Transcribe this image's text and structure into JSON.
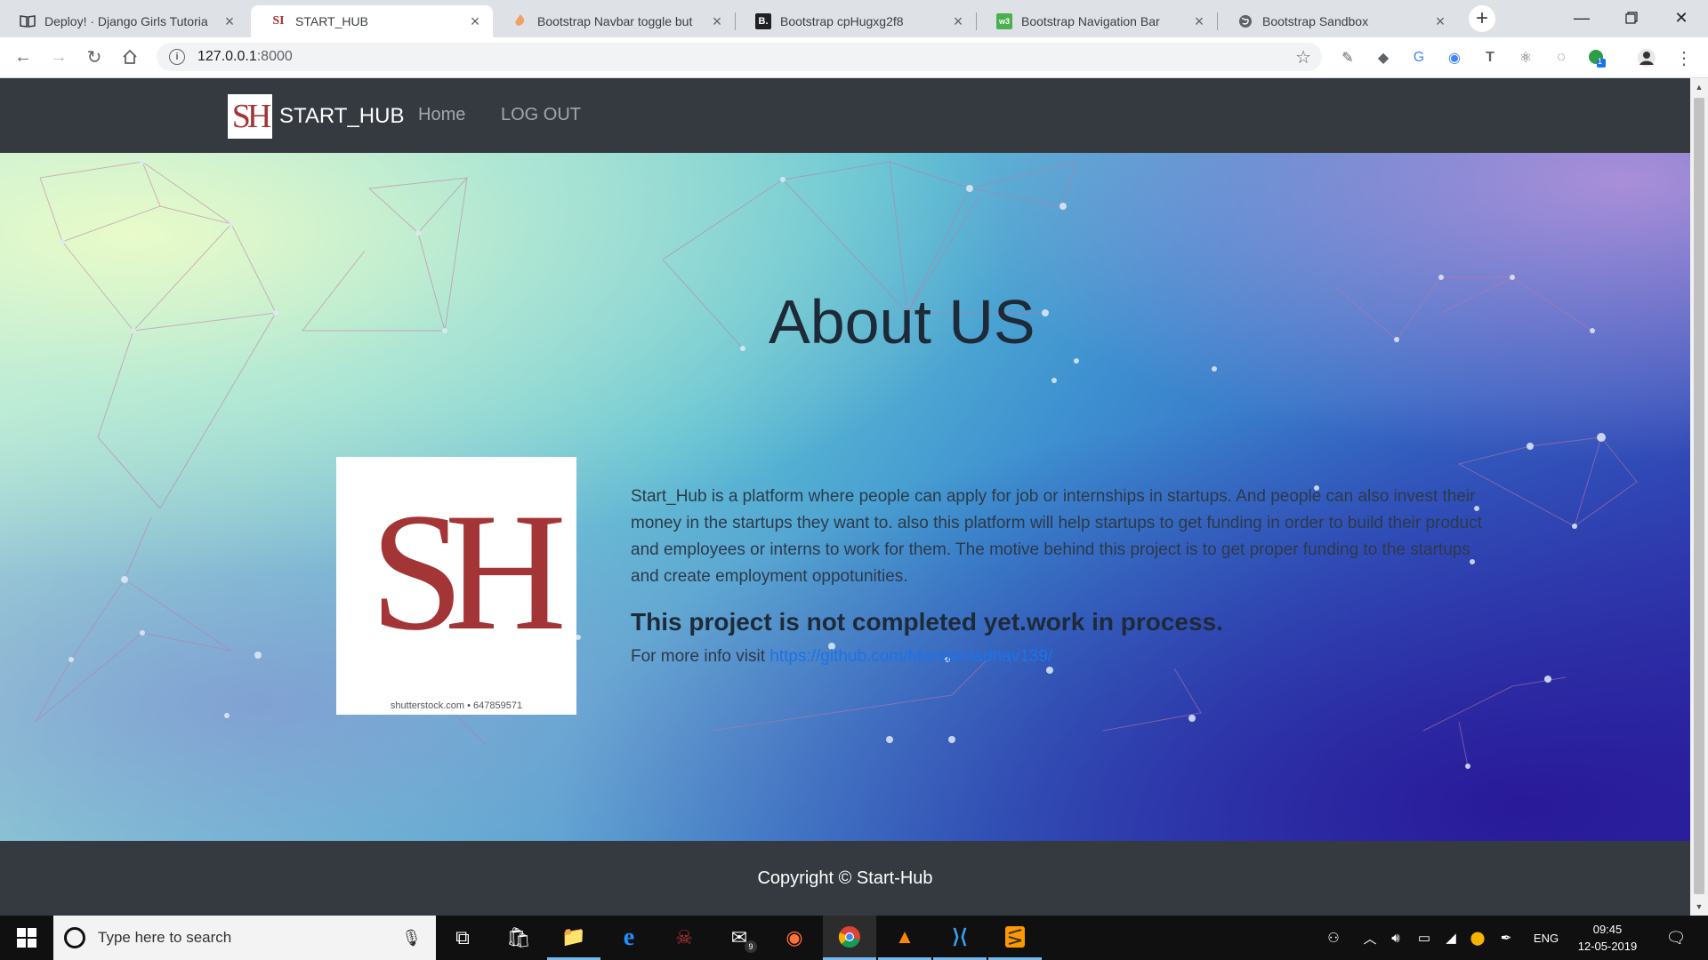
{
  "browser": {
    "tabs": [
      {
        "title": "Deploy! · Django Girls Tutoria",
        "favicon": "book-icon",
        "active": false
      },
      {
        "title": "START_HUB",
        "favicon": "sh-logo-icon",
        "active": true
      },
      {
        "title": "Bootstrap Navbar toggle but",
        "favicon": "codeply-icon",
        "active": false
      },
      {
        "title": "Bootstrap cpHugxg2f8",
        "favicon": "bootply-icon",
        "active": false
      },
      {
        "title": "Bootstrap Navigation Bar",
        "favicon": "w3-icon",
        "active": false
      },
      {
        "title": "Bootstrap Sandbox",
        "favicon": "globe-icon",
        "active": false
      }
    ],
    "url_host": "127.0.0.1",
    "url_port": ":8000",
    "extension_badge": "1"
  },
  "site": {
    "brand_mark": "SH",
    "brand_name": "START_HUB",
    "nav": {
      "home": "Home",
      "logout": "LOG OUT"
    },
    "about": {
      "title": "About US",
      "logo_mark": "SH",
      "logo_credit": "shutterstock.com • 647859571",
      "description": "Start_Hub is a platform where people can apply for job or internships in startups. And people can also invest their money in the startups they want to. also this platform will help startups to get funding in order to build their product and employees or interns to work for them. The motive behind this project is to get proper funding to the startups and create employment oppotunities.",
      "notice": "This project is not completed yet.work in process.",
      "more_prefix": "For more info visit ",
      "more_link": "https://github.com/MandarJadhav139/"
    },
    "footer": "Copyright © Start-Hub"
  },
  "taskbar": {
    "search_placeholder": "Type here to search",
    "mail_badge": "9",
    "language": "ENG",
    "time": "09:45",
    "date": "12-05-2019"
  },
  "colors": {
    "navbar": "#343a40",
    "brand_red": "#a33536",
    "link_blue": "#1a73e8"
  }
}
